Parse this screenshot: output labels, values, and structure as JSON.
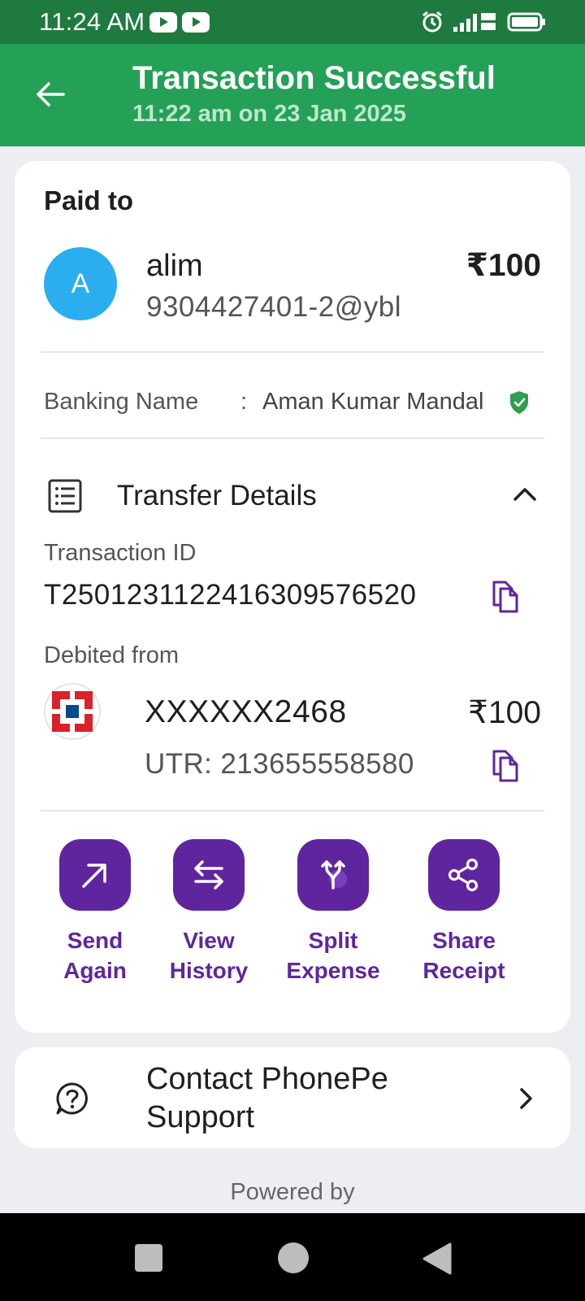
{
  "status_bar": {
    "time": "11:24 AM"
  },
  "header": {
    "title": "Transaction Successful",
    "subtitle": "11:22 am on 23 Jan 2025"
  },
  "paid_to": {
    "label": "Paid to",
    "avatar_letter": "A",
    "name": "alim",
    "upi_id": "9304427401-2@ybl",
    "amount": "₹100"
  },
  "banking": {
    "label": "Banking Name",
    "separator": ":",
    "value": "Aman Kumar Mandal"
  },
  "transfer_details": {
    "title": "Transfer Details",
    "transaction_id_label": "Transaction ID",
    "transaction_id": "T2501231122416309576520",
    "debited_from_label": "Debited from",
    "account_number": "XXXXXX2468",
    "account_amount": "₹100",
    "utr": "UTR: 213655558580"
  },
  "actions": [
    {
      "line1": "Send",
      "line2": "Again"
    },
    {
      "line1": "View",
      "line2": "History"
    },
    {
      "line1": "Split",
      "line2": "Expense"
    },
    {
      "line1": "Share",
      "line2": "Receipt"
    }
  ],
  "support": {
    "line1": "Contact PhonePe",
    "line2": "Support"
  },
  "footer": {
    "powered_by": "Powered by"
  },
  "colors": {
    "status_bar": "#1f7a3f",
    "header": "#24a157",
    "accent_purple": "#5f259f",
    "avatar": "#2aaef0",
    "verified_green": "#2e9e4f",
    "bank_red": "#d8232a",
    "bank_blue": "#004c8f"
  }
}
